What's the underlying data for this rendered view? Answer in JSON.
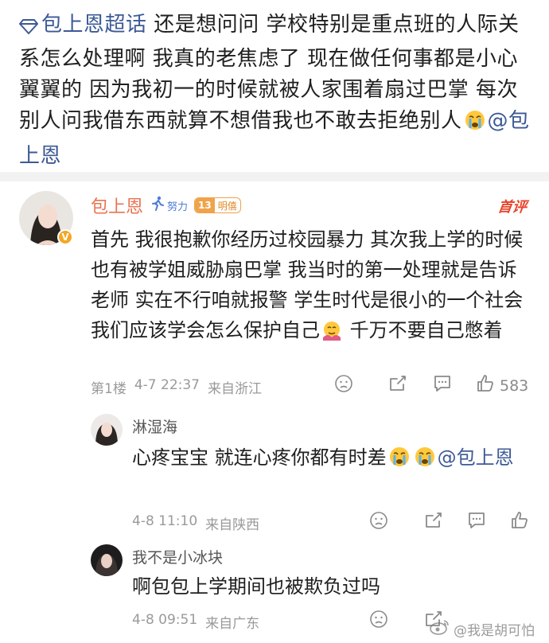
{
  "post": {
    "topic": "包上恩超话",
    "body": " 还是想问问 学校特别是重点班的人际关系怎么处理啊 我真的老焦虑了 现在做任何事都是小心翼翼的 因为我初一的时候就被人家围着扇过巴掌 每次别人问我借东西就算不想借我也不敢去拒绝别人",
    "mention": "@包上恩"
  },
  "comment": {
    "author": "包上恩",
    "level_label": "努力",
    "fan_level": "13",
    "fan_label": "明僖",
    "hot_tag": "首评",
    "text_a": "首先 我很抱歉你经历过校园暴力 其次我上学的时候也有被学姐威胁扇巴掌 我当时的第一处理就是告诉老师 实在不行咱就报警 学生时代是很小的一个社会 我们应该学会怎么保护自己",
    "text_b": " 千万不要自己憋着",
    "floor": "第1楼",
    "time": "4-7 22:37",
    "location": "来自浙江",
    "like_count": "583"
  },
  "replies": [
    {
      "author": "淋湿海",
      "text": "心疼宝宝 就连心疼你都有时差",
      "mention": "@包上恩",
      "time": "4-8 11:10",
      "location": "来自陕西"
    },
    {
      "author": "我不是小冰块",
      "text": "啊包包上学期间也被欺负过吗",
      "time": "4-8 09:51",
      "location": "来自广东"
    }
  ],
  "watermark": "@我是胡可怕",
  "icons": {
    "topic": "diamond-icon",
    "sad": "sad-face-icon",
    "repost": "repost-icon",
    "comment": "comment-icon",
    "like": "thumbs-up-icon",
    "crying": "crying-emoji-icon",
    "hug": "hug-emoji-icon",
    "runner": "runner-icon"
  },
  "colors": {
    "link": "#3d5a96",
    "author": "#eb7350",
    "hot": "#e8452c",
    "meta": "#9a9a9a"
  }
}
